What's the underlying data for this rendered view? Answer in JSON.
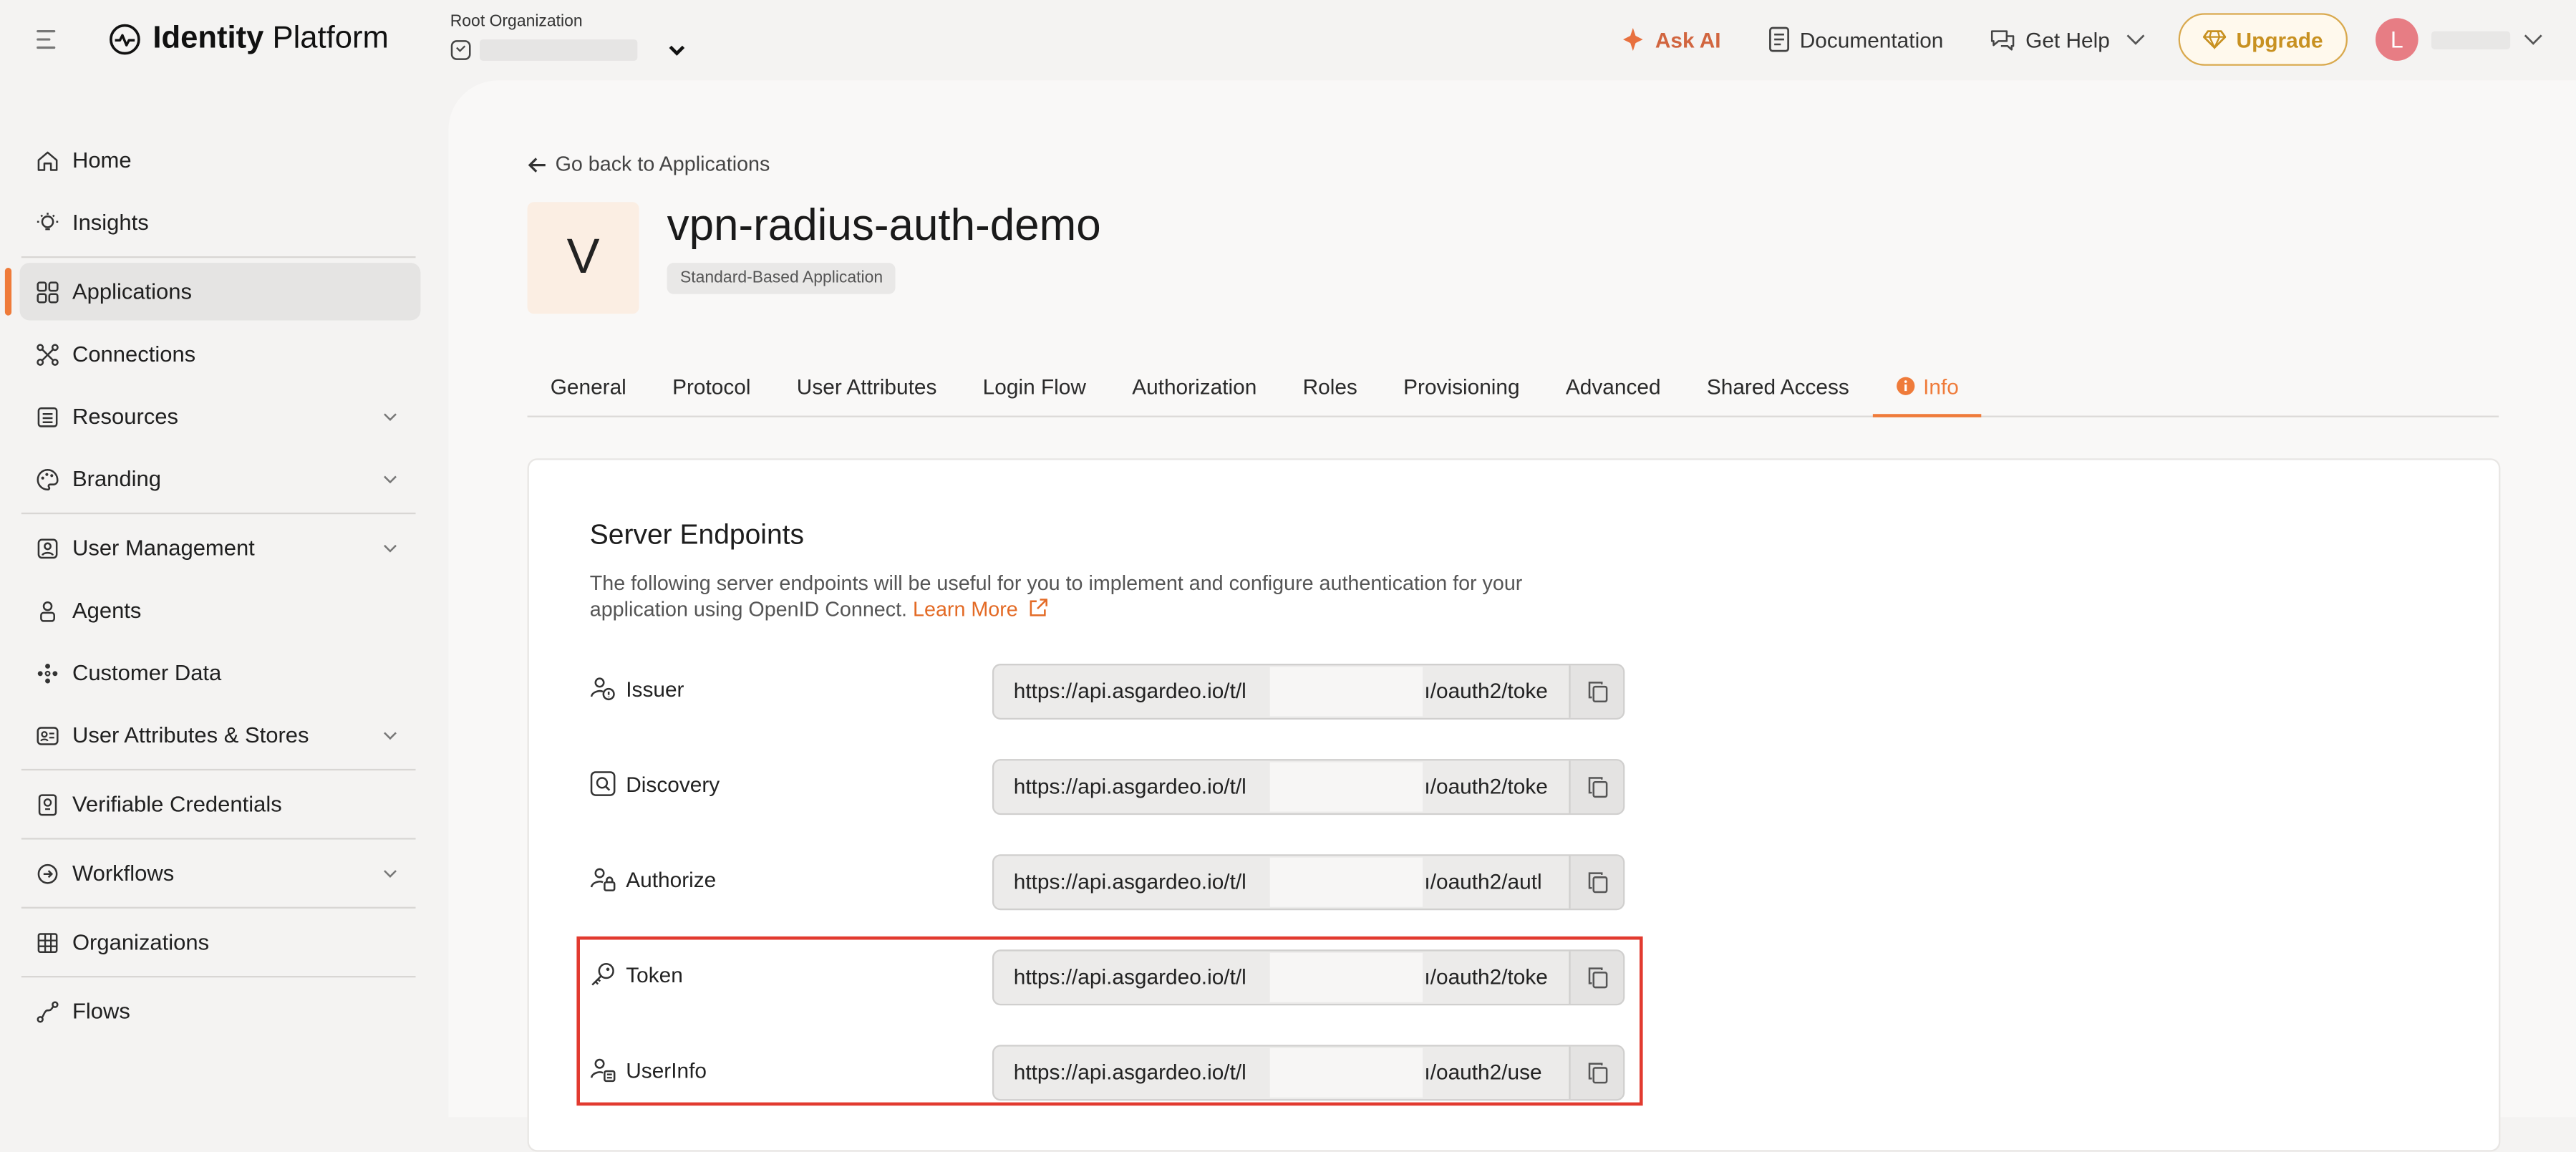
{
  "header": {
    "brand_prefix": "Identity",
    "brand_suffix": " Platform",
    "org_label": "Root Organization",
    "ask_ai": "Ask AI",
    "documentation": "Documentation",
    "get_help": "Get Help",
    "upgrade": "Upgrade",
    "user_initial": "L"
  },
  "sidebar": {
    "items": [
      {
        "label": "Home",
        "icon": "home-icon"
      },
      {
        "label": "Insights",
        "icon": "bulb-icon"
      },
      {
        "label": "Applications",
        "icon": "apps-grid-icon",
        "active": true
      },
      {
        "label": "Connections",
        "icon": "connections-icon"
      },
      {
        "label": "Resources",
        "icon": "resources-icon",
        "expandable": true
      },
      {
        "label": "Branding",
        "icon": "palette-icon",
        "expandable": true
      },
      {
        "label": "User Management",
        "icon": "user-badge-icon",
        "expandable": true
      },
      {
        "label": "Agents",
        "icon": "agent-icon"
      },
      {
        "label": "Customer Data",
        "icon": "customer-data-icon"
      },
      {
        "label": "User Attributes & Stores",
        "icon": "attributes-icon",
        "expandable": true
      },
      {
        "label": "Verifiable Credentials",
        "icon": "credential-icon"
      },
      {
        "label": "Workflows",
        "icon": "workflow-icon",
        "expandable": true
      },
      {
        "label": "Organizations",
        "icon": "organizations-icon"
      },
      {
        "label": "Flows",
        "icon": "flows-icon"
      }
    ]
  },
  "main": {
    "back_link": "Go back to Applications",
    "app_initial": "V",
    "app_name": "vpn-radius-auth-demo",
    "app_type": "Standard-Based Application",
    "tabs": [
      "General",
      "Protocol",
      "User Attributes",
      "Login Flow",
      "Authorization",
      "Roles",
      "Provisioning",
      "Advanced",
      "Shared Access",
      "Info"
    ],
    "active_tab": "Info",
    "section": {
      "title": "Server Endpoints",
      "description": "The following server endpoints will be useful for you to implement and configure authentication for your application using OpenID Connect.",
      "learn_more": "Learn More",
      "endpoints": [
        {
          "label": "Issuer",
          "url_start": "https://api.asgardeo.io/t/l",
          "url_end": "ı/oauth2/toke",
          "icon": "issuer-icon"
        },
        {
          "label": "Discovery",
          "url_start": "https://api.asgardeo.io/t/l",
          "url_end": "ı/oauth2/toke",
          "icon": "discovery-icon"
        },
        {
          "label": "Authorize",
          "url_start": "https://api.asgardeo.io/t/l",
          "url_end": "ı/oauth2/autl",
          "icon": "authorize-icon"
        },
        {
          "label": "Token",
          "url_start": "https://api.asgardeo.io/t/l",
          "url_end": "ı/oauth2/toke",
          "icon": "token-key-icon"
        },
        {
          "label": "UserInfo",
          "url_start": "https://api.asgardeo.io/t/l",
          "url_end": "ı/oauth2/use",
          "icon": "userinfo-icon"
        }
      ]
    }
  },
  "colors": {
    "accent": "#ef7b3a",
    "highlight": "#e23a2f",
    "upgrade": "#c89121"
  }
}
